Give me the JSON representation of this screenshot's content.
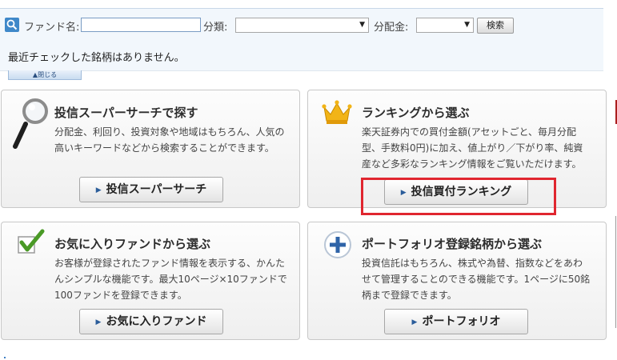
{
  "search": {
    "fund_name_label": "ファンド名:",
    "fund_name_value": "",
    "category_label": "分類:",
    "category_value": "",
    "dividend_label": "分配金:",
    "dividend_value": "",
    "search_button": "検索"
  },
  "recent": {
    "message": "最近チェックした銘柄はありません。",
    "close_label": "▲閉じる"
  },
  "cards": {
    "search": {
      "title": "投信スーパーサーチで探す",
      "desc": [
        "分配金、利回り、投資対象や地域はもちろん、人気の",
        "高いキーワードなどから検索することができます。"
      ],
      "button": "投信スーパーサーチ"
    },
    "ranking": {
      "title": "ランキングから選ぶ",
      "desc": [
        "楽天証券内での買付金額(アセットごと、毎月分配",
        "型、手数料0円)に加え、値上がり／下がり率、純資",
        "産など多彩なランキング情報をご覧いただけます。"
      ],
      "button": "投信買付ランキング"
    },
    "favorites": {
      "title": "お気に入りファンドから選ぶ",
      "desc": [
        "お客様が登録されたファンド情報を表示する、かんた",
        "んシンプルな機能です。最大10ページ×10ファンドで",
        "100ファンドを登録できます。"
      ],
      "button": "お気に入りファンド"
    },
    "portfolio": {
      "title": "ポートフォリオ登録銘柄から選ぶ",
      "desc": [
        "投資信託はもちろん、株式や為替、指数などをあわ",
        "せて管理することのできる機能です。1ページに50銘",
        "柄まで登録できます。"
      ],
      "button": "ポートフォリオ"
    }
  },
  "colors": {
    "accent_blue": "#3f88c9",
    "highlight_red": "#e0262f",
    "crown_gold": "#f2b417",
    "check_green": "#4a9a26"
  },
  "icons": {
    "search_bar": "magnifier-icon",
    "search_card": "magnifying-glass-icon",
    "ranking_card": "crown-icon",
    "favorites_card": "checkmark-icon",
    "portfolio_card": "plus-circle-icon"
  }
}
